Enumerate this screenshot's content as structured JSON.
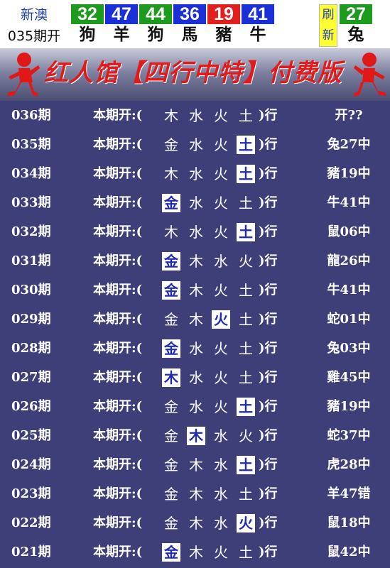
{
  "header": {
    "region": "新澳",
    "period_label": "035期开",
    "balls": [
      {
        "number": "32",
        "zodiac": "狗",
        "color": "#1e9b1e"
      },
      {
        "number": "47",
        "zodiac": "羊",
        "color": "#1a2fd6"
      },
      {
        "number": "44",
        "zodiac": "狗",
        "color": "#1e9b1e"
      },
      {
        "number": "36",
        "zodiac": "馬",
        "color": "#1a2fd6"
      },
      {
        "number": "19",
        "zodiac": "豬",
        "color": "#e01f1f"
      },
      {
        "number": "41",
        "zodiac": "牛",
        "color": "#1a2fd6"
      }
    ],
    "refresh_top": "刷",
    "refresh_bottom": "新",
    "special": {
      "number": "27",
      "zodiac": "兔",
      "color": "#1e9b1e"
    }
  },
  "banner": {
    "title": "红人馆【四行中特】付费版"
  },
  "table": {
    "label": "本期开:(",
    "close": ")行",
    "rows": [
      {
        "period": "036期",
        "elements": [
          "木",
          "水",
          "火",
          "土"
        ],
        "highlight": [],
        "result": "开??"
      },
      {
        "period": "035期",
        "elements": [
          "金",
          "水",
          "火",
          "土"
        ],
        "highlight": [
          3
        ],
        "result": "兔27中"
      },
      {
        "period": "034期",
        "elements": [
          "木",
          "水",
          "火",
          "土"
        ],
        "highlight": [
          3
        ],
        "result": "豬19中"
      },
      {
        "period": "033期",
        "elements": [
          "金",
          "水",
          "火",
          "土"
        ],
        "highlight": [
          0
        ],
        "result": "牛41中"
      },
      {
        "period": "032期",
        "elements": [
          "木",
          "水",
          "火",
          "土"
        ],
        "highlight": [
          3
        ],
        "result": "鼠06中"
      },
      {
        "period": "031期",
        "elements": [
          "金",
          "木",
          "水",
          "火"
        ],
        "highlight": [
          0
        ],
        "result": "龍26中"
      },
      {
        "period": "030期",
        "elements": [
          "金",
          "木",
          "火",
          "土"
        ],
        "highlight": [
          0
        ],
        "result": "牛41中"
      },
      {
        "period": "029期",
        "elements": [
          "金",
          "木",
          "火",
          "土"
        ],
        "highlight": [
          2
        ],
        "result": "蛇01中"
      },
      {
        "period": "028期",
        "elements": [
          "金",
          "水",
          "火",
          "土"
        ],
        "highlight": [
          0
        ],
        "result": "兔03中"
      },
      {
        "period": "027期",
        "elements": [
          "木",
          "水",
          "火",
          "土"
        ],
        "highlight": [
          0
        ],
        "result": "雞45中"
      },
      {
        "period": "026期",
        "elements": [
          "金",
          "水",
          "火",
          "土"
        ],
        "highlight": [
          3
        ],
        "result": "豬19中"
      },
      {
        "period": "025期",
        "elements": [
          "金",
          "木",
          "水",
          "火"
        ],
        "highlight": [
          1
        ],
        "result": "蛇37中"
      },
      {
        "period": "024期",
        "elements": [
          "金",
          "木",
          "水",
          "土"
        ],
        "highlight": [
          3
        ],
        "result": "虎28中"
      },
      {
        "period": "023期",
        "elements": [
          "金",
          "木",
          "水",
          "土"
        ],
        "highlight": [],
        "result": "羊47错"
      },
      {
        "period": "022期",
        "elements": [
          "金",
          "木",
          "水",
          "火"
        ],
        "highlight": [
          3
        ],
        "result": "鼠18中"
      },
      {
        "period": "021期",
        "elements": [
          "金",
          "木",
          "火",
          "土"
        ],
        "highlight": [
          0
        ],
        "result": "鼠42中"
      }
    ]
  }
}
